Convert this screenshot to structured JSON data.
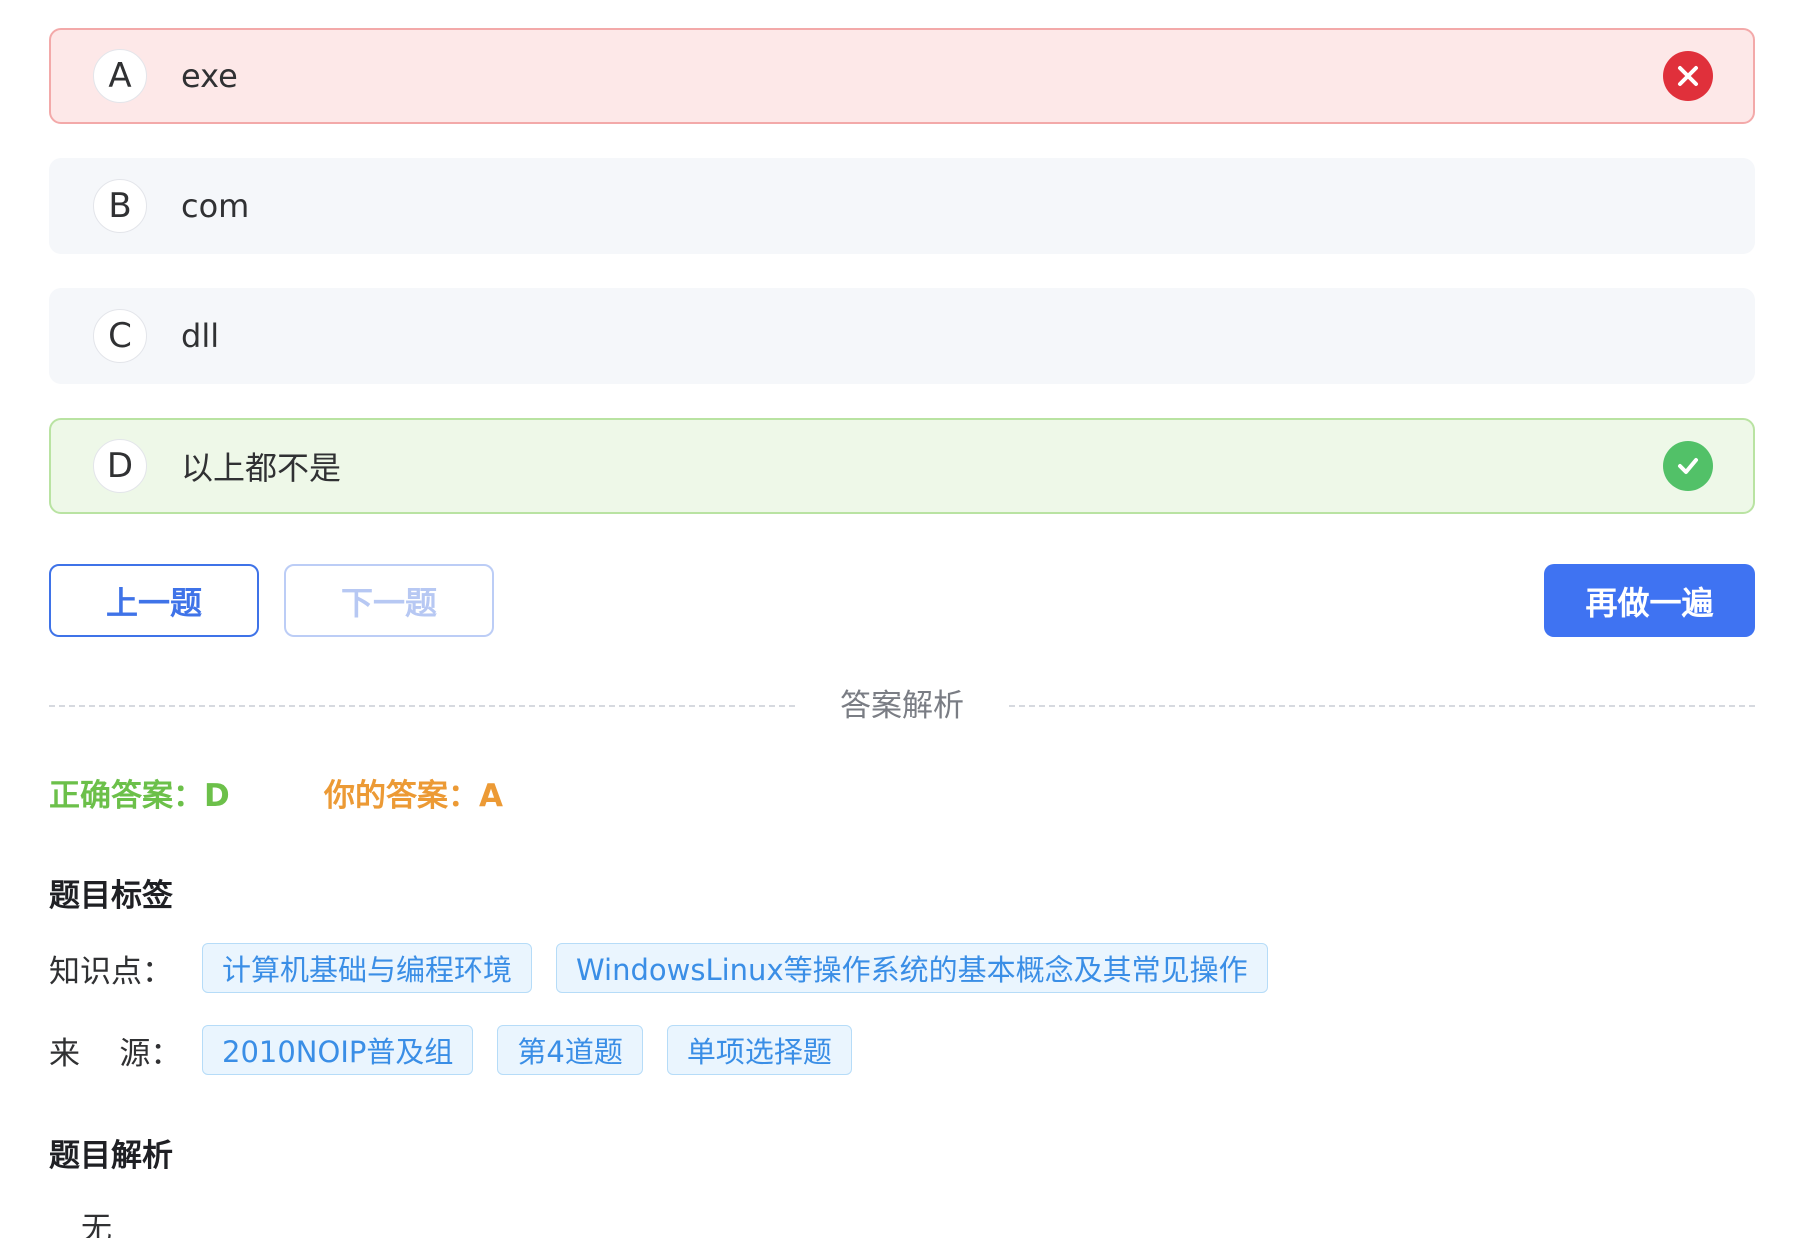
{
  "options": [
    {
      "letter": "A",
      "text": "exe",
      "state": "wrong",
      "status_icon": "close-icon"
    },
    {
      "letter": "B",
      "text": "com",
      "state": "neutral"
    },
    {
      "letter": "C",
      "text": "dll",
      "state": "neutral"
    },
    {
      "letter": "D",
      "text": "以上都不是",
      "state": "right",
      "status_icon": "check-icon"
    }
  ],
  "buttons": {
    "prev_label": "上一题",
    "next_label": "下一题",
    "redo_label": "再做一遍"
  },
  "analysis": {
    "divider_title": "答案解析",
    "correct_answer": "正确答案：D",
    "your_answer": "你的答案：A",
    "tags_heading": "题目标签",
    "knowledge_label": "知识点：",
    "knowledge_tags": [
      "计算机基础与编程环境",
      "WindowsLinux等操作系统的基本概念及其常见操作"
    ],
    "source_label": "来    源：",
    "source_tags": [
      "2010NOIP普及组",
      "第4道题",
      "单项选择题"
    ],
    "explanation_heading": "题目解析",
    "explanation_text": "无"
  },
  "colors": {
    "wrong": "#e0303b",
    "right": "#52c168",
    "primary": "#3f73f2",
    "correct_text": "#6cc04a",
    "your_text": "#ec9a35"
  }
}
